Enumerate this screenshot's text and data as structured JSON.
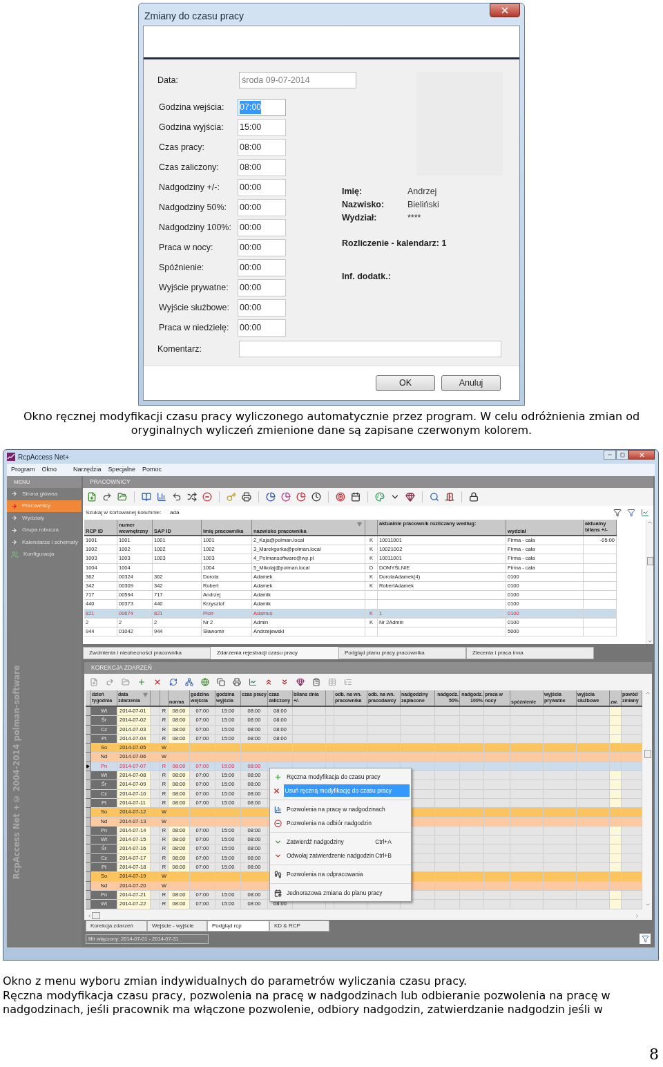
{
  "dialog": {
    "title": "Zmiany do czasu pracy",
    "date": {
      "label": "Data:",
      "value": "środa 09-07-2014",
      "disabled": true
    },
    "fields": [
      {
        "label": "Godzina wejścia:",
        "value": "07:00",
        "selected": true
      },
      {
        "label": "Godzina wyjścia:",
        "value": "15:00",
        "selected": false
      },
      {
        "label": "Czas pracy:",
        "value": "08:00",
        "selected": false
      },
      {
        "label": "Czas zaliczony:",
        "value": "08:00",
        "selected": false
      },
      {
        "label": "Nadgodziny +/-:",
        "value": "00:00",
        "selected": false
      },
      {
        "label": "Nadgodziny 50%:",
        "value": "00:00",
        "selected": false
      },
      {
        "label": "Nadgodziny 100%:",
        "value": "00:00",
        "selected": false
      },
      {
        "label": "Praca w nocy:",
        "value": "00:00",
        "selected": false
      },
      {
        "label": "Spóźnienie:",
        "value": "00:00",
        "selected": false
      },
      {
        "label": "Wyjście prywatne:",
        "value": "00:00",
        "selected": false
      },
      {
        "label": "Wyjście służbowe:",
        "value": "00:00",
        "selected": false
      },
      {
        "label": "Praca w niedzielę:",
        "value": "00:00",
        "selected": false
      }
    ],
    "info": [
      {
        "label": "Imię:",
        "value": "Andrzej"
      },
      {
        "label": "Nazwisko:",
        "value": "Bieliński"
      },
      {
        "label": "Wydział:",
        "value": "****"
      }
    ],
    "settlement": "Rozliczenie - kalendarz: 1",
    "extra_label": "Inf. dodatk.:",
    "comment_label": "Komentarz:",
    "buttons": [
      "OK",
      "Anuluj"
    ]
  },
  "caption_1": "Okno ręcznej modyfikacji czasu pracy wyliczonego automatycznie przez program. W celu odróżnienia zmian od oryginalnych wyliczeń zmienione dane są zapisane czerwonym kolorem.",
  "app": {
    "title": "RcpAccess Net+",
    "menu": [
      "Program",
      "Okno",
      "Narzędzia",
      "Specjalne",
      "Pomoc"
    ],
    "sidebar": {
      "header": "MENU",
      "items": [
        {
          "label": "Strona główna",
          "selected": false
        },
        {
          "label": "Pracownicy",
          "selected": true
        },
        {
          "label": "Wydziały",
          "selected": false
        },
        {
          "label": "Grupa robocza",
          "selected": false
        },
        {
          "label": "Kalendarze i schematy",
          "selected": false
        },
        {
          "label": "Konfiguracja",
          "selected": false
        }
      ],
      "brand": [
        "RcpAccess Net +",
        "© 2004-2014 polman-software"
      ]
    },
    "employees": {
      "header": "PRACOWNICY",
      "search": {
        "label": "Szukaj w sortowanej kolumnie:",
        "value": "ada"
      },
      "columns": [
        "RCP ID",
        "numer wewnętrzny",
        "SAP ID",
        "imię pracownika",
        "nazwisko pracownika",
        null,
        "aktualnie pracownik rozliczany według:",
        "wydział",
        "aktualny bilans +/-"
      ],
      "rows": [
        {
          "selected": false,
          "cells": [
            "1001",
            "1001",
            "1001",
            "1001",
            "2_Kaja@polman.local",
            "K",
            "10011001",
            "Firma - cała",
            "-05:00"
          ]
        },
        {
          "selected": false,
          "cells": [
            "1002",
            "1002",
            "1002",
            "1002",
            "3_Marekgorka@polman.local",
            "K",
            "10021002",
            "Firma - cała",
            null
          ]
        },
        {
          "selected": false,
          "cells": [
            "1003",
            "1003",
            "1003",
            "1003",
            "4_Polmansoftware@wp.pl",
            "K",
            "10011001",
            "Firma - cała",
            null
          ]
        },
        {
          "selected": false,
          "cells": [
            "1004",
            "1004",
            null,
            "1004",
            "5_Mikolaj@polman.local",
            "D",
            "DOMYŚLNIE",
            "Firma - cała",
            null
          ]
        },
        {
          "selected": false,
          "cells": [
            "362",
            "00324",
            "362",
            "Dorota",
            "Adamek",
            "K",
            "DorotaAdamek(4)",
            "0100",
            null
          ]
        },
        {
          "selected": false,
          "cells": [
            "342",
            "00309",
            "342",
            "Robert",
            "Adamek",
            "K",
            "RobertAdamek",
            "0100",
            null
          ]
        },
        {
          "selected": false,
          "cells": [
            "717",
            "00594",
            "717",
            "Andrzej",
            "Adamik",
            null,
            null,
            "0100",
            null
          ]
        },
        {
          "selected": false,
          "cells": [
            "440",
            "00373",
            "440",
            "Krzysztof",
            "Adamik",
            null,
            null,
            "0100",
            null
          ]
        },
        {
          "selected": true,
          "cells": [
            "821",
            "00674",
            "821",
            "Piotr",
            "Adamus",
            "K",
            "1",
            "0100",
            null
          ]
        },
        {
          "selected": false,
          "cells": [
            "2",
            "2",
            "2",
            "Nr 2",
            "Admin",
            "K",
            "Nr 2Admin",
            "0100",
            null
          ]
        },
        {
          "selected": false,
          "cells": [
            "944",
            "01042",
            "944",
            "Sławomir",
            "Andrzejewski",
            null,
            null,
            "5000",
            null
          ]
        }
      ]
    },
    "tabs": [
      {
        "label": "Zwolnienia i nieobecności pracownika",
        "selected": false
      },
      {
        "label": "Zdarzenia rejestracji czasu pracy",
        "selected": true
      },
      {
        "label": "Podgląd planu pracy pracownika",
        "selected": false
      },
      {
        "label": "Zlecenia i praca inna",
        "selected": false
      }
    ],
    "events": {
      "header": "KOREKCJA ZDARZEŃ",
      "columns": [
        "dzień tygodnia",
        "data zdarzenia",
        null,
        null,
        "norma",
        "godzina wejścia",
        "godzina wyjścia",
        "czas pracy",
        "czas zaliczony",
        "bilans dnia +/-",
        null,
        "odb. na wn. pracownika",
        "odb. na wn. pracodawcy",
        "nadgodziny zapłacone",
        "nadgodz. 50%",
        "nadgodz. 100%",
        "praca w nocy",
        "spóźnienie",
        "wyjścia prywatne",
        "wyjścia służbowe",
        "zw.",
        "powód zmiany"
      ],
      "rows": [
        {
          "day": "Wt",
          "date": "2014-07-01",
          "code": "R",
          "kind": "workday",
          "selected": false,
          "values": [
            "08:00",
            "07:00",
            "15:00",
            "08:00",
            "08:00"
          ]
        },
        {
          "day": "Śr",
          "date": "2014-07-02",
          "code": "R",
          "kind": "workday",
          "selected": false,
          "values": [
            "08:00",
            "07:00",
            "15:00",
            "08:00",
            "08:00"
          ]
        },
        {
          "day": "Cz",
          "date": "2014-07-03",
          "code": "R",
          "kind": "workday",
          "selected": false,
          "values": [
            "08:00",
            "07:00",
            "15:00",
            "08:00",
            "08:00"
          ]
        },
        {
          "day": "Pt",
          "date": "2014-07-04",
          "code": "R",
          "kind": "workday",
          "selected": false,
          "values": [
            "08:00",
            "07:00",
            "15:00",
            "08:00",
            "08:00"
          ]
        },
        {
          "day": "So",
          "date": "2014-07-05",
          "code": "W",
          "kind": "saturday",
          "selected": false
        },
        {
          "day": "Nd",
          "date": "2014-07-06",
          "code": "W",
          "kind": "sunday",
          "selected": false
        },
        {
          "day": "Pn",
          "date": "2014-07-07",
          "code": "R",
          "kind": "workday",
          "selected": true,
          "values": [
            "08:00",
            "07:00",
            "15:00",
            "08:00"
          ]
        },
        {
          "day": "Wt",
          "date": "2014-07-08",
          "code": "R",
          "kind": "workday",
          "selected": false,
          "values": [
            "08:00",
            "07:00",
            "15:00",
            "08:00"
          ]
        },
        {
          "day": "Śr",
          "date": "2014-07-09",
          "code": "R",
          "kind": "workday",
          "selected": false,
          "values": [
            "08:00",
            "07:00",
            "15:00",
            "08:00"
          ]
        },
        {
          "day": "Cz",
          "date": "2014-07-10",
          "code": "R",
          "kind": "workday",
          "selected": false,
          "values": [
            "08:00",
            "07:00",
            "15:00",
            "08:00"
          ]
        },
        {
          "day": "Pt",
          "date": "2014-07-11",
          "code": "R",
          "kind": "workday",
          "selected": false,
          "values": [
            "08:00",
            "07:00",
            "15:00",
            "08:00"
          ]
        },
        {
          "day": "So",
          "date": "2014-07-12",
          "code": "W",
          "kind": "saturday",
          "selected": false
        },
        {
          "day": "Nd",
          "date": "2014-07-13",
          "code": "W",
          "kind": "sunday",
          "selected": false
        },
        {
          "day": "Pn",
          "date": "2014-07-14",
          "code": "R",
          "kind": "workday",
          "selected": false,
          "values": [
            "08:00",
            "07:00",
            "15:00",
            "08:00"
          ]
        },
        {
          "day": "Wt",
          "date": "2014-07-15",
          "code": "R",
          "kind": "workday",
          "selected": false,
          "values": [
            "08:00",
            "07:00",
            "15:00",
            "08:00"
          ]
        },
        {
          "day": "Śr",
          "date": "2014-07-16",
          "code": "R",
          "kind": "workday",
          "selected": false,
          "values": [
            "08:00",
            "07:00",
            "15:00",
            "08:00"
          ]
        },
        {
          "day": "Cz",
          "date": "2014-07-17",
          "code": "R",
          "kind": "workday",
          "selected": false,
          "values": [
            "08:00",
            "07:00",
            "15:00",
            "08:00"
          ]
        },
        {
          "day": "Pt",
          "date": "2014-07-18",
          "code": "R",
          "kind": "workday",
          "selected": false,
          "values": [
            "08:00",
            "07:00",
            "15:00",
            "08:00"
          ]
        },
        {
          "day": "So",
          "date": "2014-07-19",
          "code": "W",
          "kind": "saturday",
          "selected": false
        },
        {
          "day": "Nd",
          "date": "2014-07-20",
          "code": "W",
          "kind": "sunday",
          "selected": false
        },
        {
          "day": "Pn",
          "date": "2014-07-21",
          "code": "R",
          "kind": "workday",
          "selected": false,
          "values": [
            "08:00",
            "07:00",
            "15:00",
            "08:00"
          ]
        },
        {
          "day": "Wt",
          "date": "2014-07-22",
          "code": "R",
          "kind": "workday",
          "selected": false,
          "values": [
            "08:00",
            "07:00",
            "15:00",
            "08:00",
            "08:00"
          ]
        }
      ]
    },
    "context_menu": {
      "groups": [
        [
          {
            "label": "Ręczna modyfikacja do czasu pracy",
            "selected": false
          },
          {
            "label": "Usuń ręczną modyfikację do czasu pracy",
            "selected": true
          }
        ],
        [
          {
            "label": "Pozwolenia na pracę w nadgodzinach",
            "selected": false
          },
          {
            "label": "Pozwolenia na odbiór nadgodzin",
            "selected": false
          }
        ],
        [
          {
            "label": "Zatwierdź nadgodziny",
            "shortcut": "Ctrl+A",
            "selected": false
          },
          {
            "label": "Odwołaj zatwierdzenie nadgodzin",
            "shortcut": "Ctrl+B",
            "selected": false
          }
        ],
        [
          {
            "label": "Pozwolenia na odpracowania",
            "selected": false
          }
        ],
        [
          {
            "label": "Jednorazowa zmiana do planu pracy",
            "selected": false
          }
        ]
      ]
    },
    "bottom_tabs": [
      {
        "label": "Korekcja zdarzeń",
        "selected": false
      },
      {
        "label": "Wejście - wyjście",
        "selected": false
      },
      {
        "label": "Podgląd rcp",
        "selected": true
      },
      {
        "label": "KD & RCP",
        "selected": false
      }
    ],
    "filter": "filtr włączony: 2014-07-01 - 2014-07-31"
  },
  "caption_2": "Okno z menu wyboru zmian indywidualnych do parametrów wyliczania czasu pracy.",
  "caption_3": "Ręczna modyfikacja czasu pracy, pozwolenia na pracę w nadgodzinach lub odbieranie pozwolenia na pracę w nadgodzinach, jeśli pracownik ma włączone pozwolenie, odbiory nadgodzin, zatwierdzanie nadgodzin jeśli w",
  "page_number": "8"
}
